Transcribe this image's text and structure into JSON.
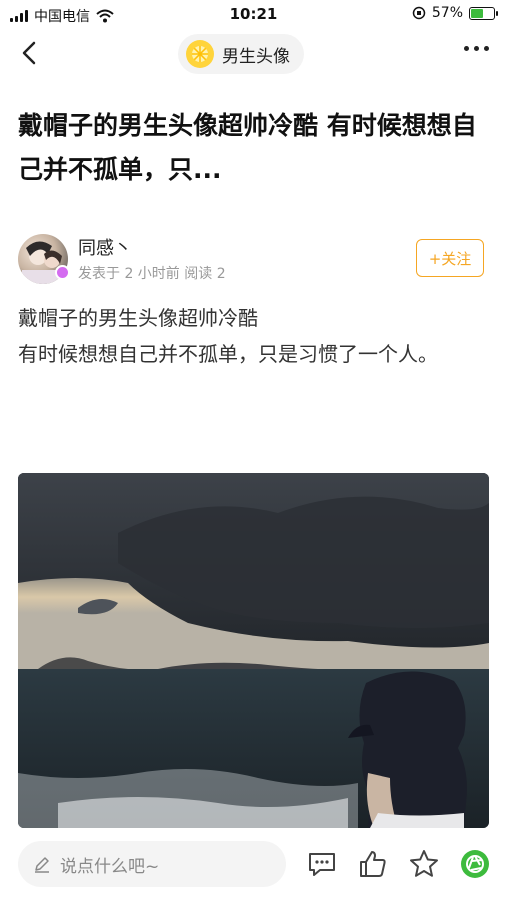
{
  "status_bar": {
    "carrier": "中国电信",
    "time": "10:21",
    "battery": "57%",
    "battery_level": 0.57
  },
  "header": {
    "circle_name": "男生头像"
  },
  "post": {
    "title": "戴帽子的男生头像超帅冷酷 有时候想想自己并不孤单，只...",
    "author": {
      "name": "同感丶",
      "meta": "发表于 2 小时前  阅读 2"
    },
    "follow_label": "+关注",
    "body_lines": [
      "戴帽子的男生头像超帅冷酷",
      "有时候想想自己并不孤单，只是习惯了一个人。"
    ]
  },
  "bottom_bar": {
    "comment_placeholder": "说点什么吧~"
  },
  "icons": {
    "back": "chevron-left-icon",
    "more": "more-dots-icon",
    "circle": "lemon-icon",
    "comment": "comment-bubble-icon",
    "like": "thumbs-up-icon",
    "favorite": "star-icon",
    "share": "camera-aperture-icon",
    "edit": "pencil-icon",
    "wifi": "wifi-icon"
  },
  "colors": {
    "accent": "#f5a623",
    "share_green": "#3dbb3d",
    "lemon": "#ffd43b"
  }
}
